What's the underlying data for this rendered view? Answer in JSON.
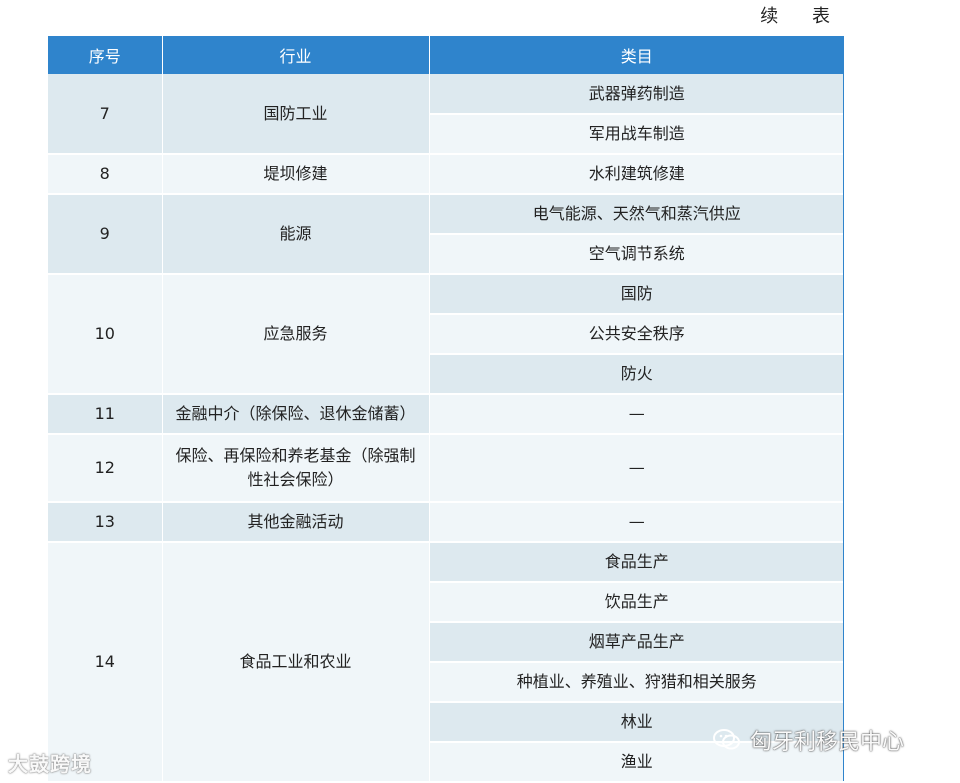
{
  "continued_label": "续 表",
  "headers": [
    "序号",
    "行业",
    "类目"
  ],
  "rows": [
    {
      "no": "7",
      "industry": "国防工业",
      "categories": [
        "武器弹药制造",
        "军用战车制造"
      ]
    },
    {
      "no": "8",
      "industry": "堤坝修建",
      "categories": [
        "水利建筑修建"
      ]
    },
    {
      "no": "9",
      "industry": "能源",
      "categories": [
        "电气能源、天然气和蒸汽供应",
        "空气调节系统"
      ]
    },
    {
      "no": "10",
      "industry": "应急服务",
      "categories": [
        "国防",
        "公共安全秩序",
        "防火"
      ]
    },
    {
      "no": "11",
      "industry": "金融中介（除保险、退休金储蓄）",
      "categories": [
        "—"
      ]
    },
    {
      "no": "12",
      "industry": "保险、再保险和养老基金（除强制性社会保险）",
      "categories": [
        "—"
      ]
    },
    {
      "no": "13",
      "industry": "其他金融活动",
      "categories": [
        "—"
      ]
    },
    {
      "no": "14",
      "industry": "食品工业和农业",
      "categories": [
        "食品生产",
        "饮品生产",
        "烟草产品生产",
        "种植业、养殖业、狩猎和相关服务",
        "林业",
        "渔业"
      ]
    }
  ],
  "watermark_left": "大鼓跨境",
  "watermark_right": "匈牙利移民中心",
  "colors": {
    "header": "#2f84cc",
    "row_dark": "#dde9ef",
    "row_light": "#f0f6f9"
  }
}
